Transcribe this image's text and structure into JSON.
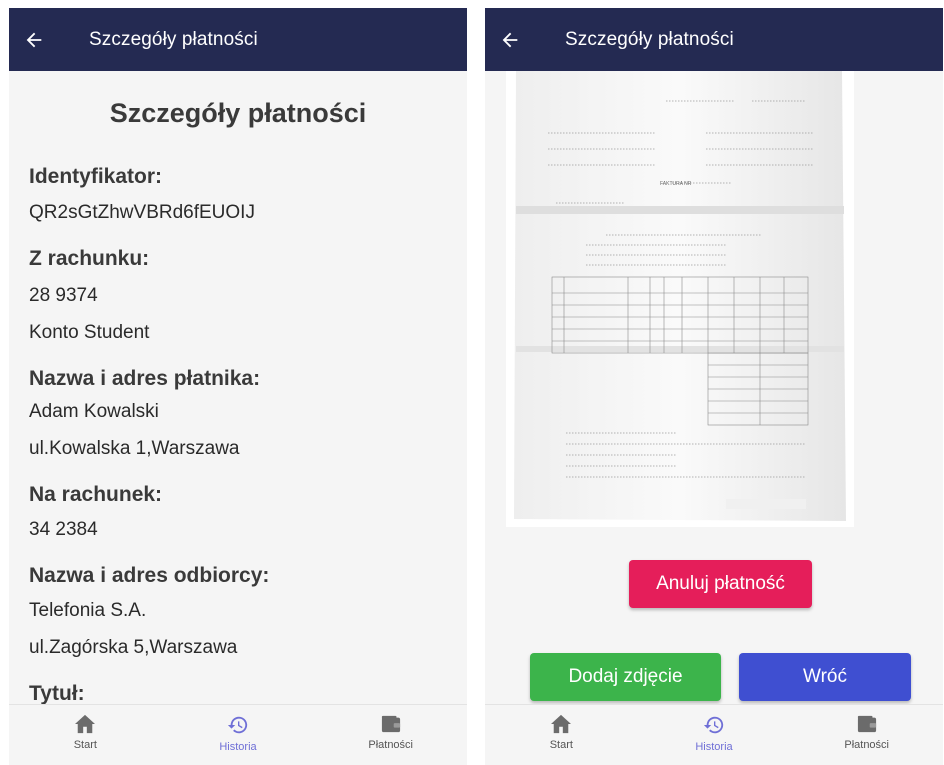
{
  "left": {
    "appbar_title": "Szczegóły płatności",
    "heading": "Szczegóły płatności",
    "fields": {
      "id_label": "Identyfikator:",
      "id_value": "QR2sGtZhwVBRd6fEUOIJ",
      "from_label": "Z rachunku:",
      "from_number": "28 9374",
      "from_name": "Konto Student",
      "payer_label": "Nazwa i adres płatnika:",
      "payer_name": "Adam Kowalski",
      "payer_address": "ul.Kowalska 1,Warszawa",
      "to_label": "Na rachunek:",
      "to_number": "34 2384",
      "recipient_label": "Nazwa i adres odbiorcy:",
      "recipient_name": "Telefonia S.A.",
      "recipient_address": "ul.Zagórska 5,Warszawa",
      "title_label": "Tytuł:"
    }
  },
  "right": {
    "appbar_title": "Szczegóły płatności",
    "invoice_heading": "FAKTURA NR",
    "cancel_label": "Anuluj płatność",
    "add_photo_label": "Dodaj zdjęcie",
    "back_label": "Wróć"
  },
  "nav": {
    "start": "Start",
    "history": "Historia",
    "payments": "Płatności"
  },
  "colors": {
    "appbar": "#242a52",
    "active_nav": "#6f6fd6",
    "cancel": "#e51e5a",
    "add_photo": "#3cb44b",
    "back": "#3f4fd1"
  },
  "icons": {
    "back": "arrow-left-icon",
    "start": "home-icon",
    "history": "history-icon",
    "payments": "wallet-icon"
  }
}
